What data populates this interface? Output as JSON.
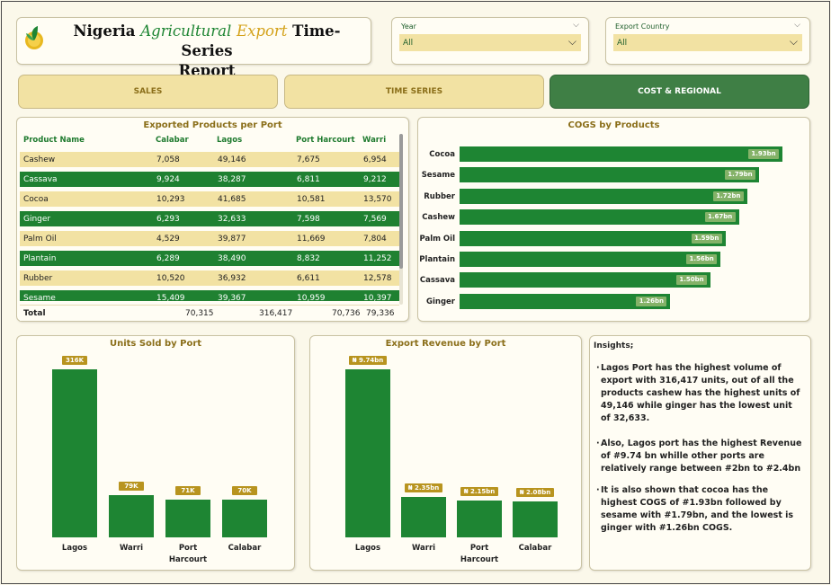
{
  "header": {
    "title_part1": "Nigeria",
    "title_part2": "Agricultural",
    "title_part3": "Export",
    "title_part4": "Time-Series",
    "title_part5": "Report"
  },
  "slicers": [
    {
      "label": "Year",
      "value": "All"
    },
    {
      "label": "Export Country",
      "value": "All"
    }
  ],
  "tabs": [
    {
      "label": "SALES",
      "active": false
    },
    {
      "label": "TIME SERIES",
      "active": false
    },
    {
      "label": "COST & REGIONAL",
      "active": true
    }
  ],
  "colors": {
    "primary_green": "#1e8533",
    "gold": "#b8941f",
    "tan": "#f2e2a3",
    "title_gold": "#8b6f1a"
  },
  "products_table": {
    "title": "Exported Products per Port",
    "columns": [
      "Product Name",
      "Calabar",
      "Lagos",
      "Port Harcourt",
      "Warri"
    ],
    "rows": [
      [
        "Cashew",
        "7,058",
        "49,146",
        "7,675",
        "6,954"
      ],
      [
        "Cassava",
        "9,924",
        "38,287",
        "6,811",
        "9,212"
      ],
      [
        "Cocoa",
        "10,293",
        "41,685",
        "10,581",
        "13,570"
      ],
      [
        "Ginger",
        "6,293",
        "32,633",
        "7,598",
        "7,569"
      ],
      [
        "Palm Oil",
        "4,529",
        "39,877",
        "11,669",
        "7,804"
      ],
      [
        "Plantain",
        "6,289",
        "38,490",
        "8,832",
        "11,252"
      ],
      [
        "Rubber",
        "10,520",
        "36,932",
        "6,611",
        "12,578"
      ],
      [
        "Sesame",
        "15,409",
        "39,367",
        "10,959",
        "10,397"
      ]
    ],
    "total": [
      "Total",
      "70,315",
      "316,417",
      "70,736",
      "79,336"
    ]
  },
  "chart_data": [
    {
      "type": "bar",
      "orientation": "horizontal",
      "title": "COGS by Products",
      "categories": [
        "Cocoa",
        "Sesame",
        "Rubber",
        "Cashew",
        "Palm Oil",
        "Plantain",
        "Cassava",
        "Ginger"
      ],
      "values": [
        1.93,
        1.79,
        1.72,
        1.67,
        1.59,
        1.56,
        1.5,
        1.26
      ],
      "data_labels": [
        "1.93bn",
        "1.79bn",
        "1.72bn",
        "1.67bn",
        "1.59bn",
        "1.56bn",
        "1.50bn",
        "1.26bn"
      ],
      "xlim": [
        0,
        2.0
      ]
    },
    {
      "type": "bar",
      "title": "Units Sold by Port",
      "categories": [
        "Lagos",
        "Warri",
        "Port Harcourt",
        "Calabar"
      ],
      "values": [
        316417,
        79336,
        70736,
        70315
      ],
      "data_labels": [
        "316K",
        "79K",
        "71K",
        "70K"
      ],
      "ylim": [
        0,
        316417
      ]
    },
    {
      "type": "bar",
      "title": "Export Revenue by Port",
      "categories": [
        "Lagos",
        "Warri",
        "Port Harcourt",
        "Calabar"
      ],
      "values": [
        9.74,
        2.35,
        2.15,
        2.08
      ],
      "data_labels": [
        "₦ 9.74bn",
        "₦ 2.35bn",
        "₦ 2.15bn",
        "₦ 2.08bn"
      ],
      "ylim": [
        0,
        9.74
      ]
    }
  ],
  "insights": {
    "heading": "Insights;",
    "points": [
      "Lagos Port has the highest volume of export with 316,417 units, out of all the products cashew has the highest units of 49,146 while ginger has the lowest unit of 32,633.",
      "Also, Lagos port has the highest Revenue of #9.74 bn whille other ports are relatively range between #2bn to #2.4bn",
      "It is also shown that cocoa has the highest COGS of #1.93bn followed by sesame with #1.79bn, and the lowest is ginger with #1.26bn COGS."
    ]
  }
}
